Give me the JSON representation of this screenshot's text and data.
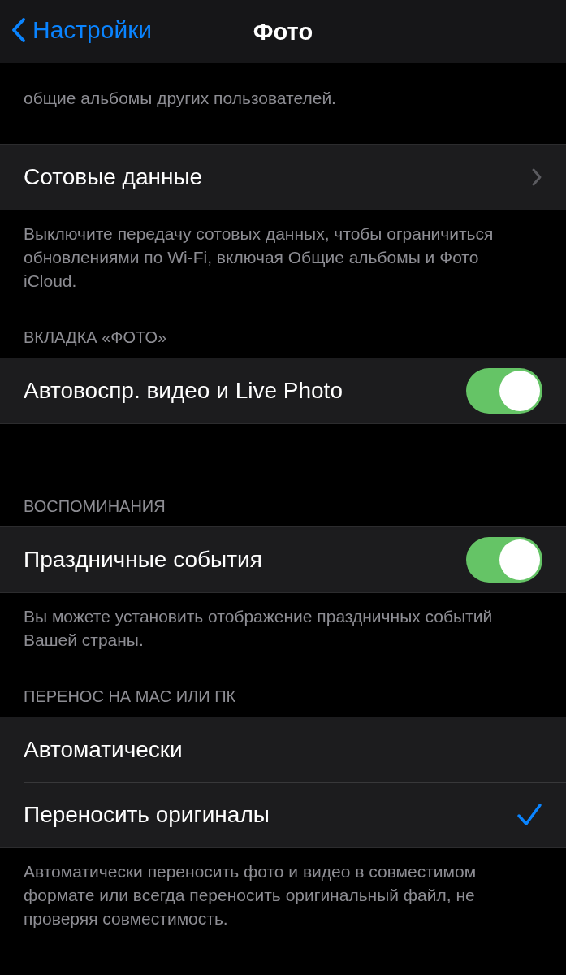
{
  "nav": {
    "back": "Настройки",
    "title": "Фото"
  },
  "sections": [
    {
      "footer": "общие альбомы других пользователей."
    },
    {
      "rows": [
        {
          "kind": "chevron",
          "label": "Сотовые данные"
        }
      ],
      "footer": "Выключите передачу сотовых данных, чтобы ограничиться обновлениями по Wi-Fi, включая Общие альбомы и Фото iCloud."
    },
    {
      "header": "ВКЛАДКА «ФОТО»",
      "rows": [
        {
          "kind": "toggle",
          "label": "Автовоспр. видео и Live Photo",
          "on": true
        }
      ]
    },
    {
      "header": "ВОСПОМИНАНИЯ",
      "rows": [
        {
          "kind": "toggle",
          "label": "Праздничные события",
          "on": true
        }
      ],
      "footer": "Вы можете установить отображение праздничных событий Вашей страны."
    },
    {
      "header": "ПЕРЕНОС НА MAC ИЛИ ПК",
      "rows": [
        {
          "kind": "check",
          "label": "Автоматически",
          "selected": false
        },
        {
          "kind": "check",
          "label": "Переносить оригиналы",
          "selected": true
        }
      ],
      "footer": "Автоматически переносить фото и видео в совместимом формате или всегда переносить оригинальный файл, не проверяя совместимость."
    }
  ]
}
